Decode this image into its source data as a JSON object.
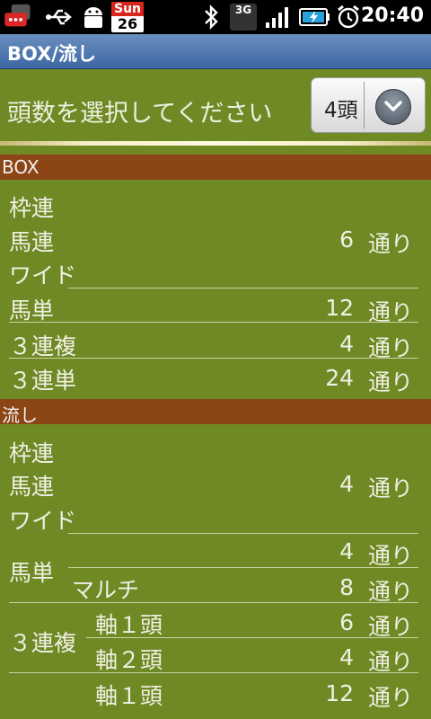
{
  "status_bar": {
    "time": "20:40",
    "calendar_day": "Sun",
    "calendar_date": "26",
    "network_label": "3G",
    "icons": [
      "messaging-icon",
      "usb-icon",
      "android-icon",
      "calendar-icon",
      "bluetooth-icon",
      "3g-icon",
      "signal-icon",
      "battery-charging-icon",
      "alarm-icon"
    ]
  },
  "title": "BOX/流し",
  "header": {
    "prompt": "頭数を選択してください",
    "spinner_value": "4頭"
  },
  "box_section": {
    "title": "BOX",
    "rows": [
      {
        "label": "枠連",
        "count": "",
        "unit": ""
      },
      {
        "label": "馬連",
        "count": "6",
        "unit": "通り"
      },
      {
        "label": "ワイド",
        "count": "",
        "unit": ""
      },
      {
        "label": "馬単",
        "count": "12",
        "unit": "通り"
      },
      {
        "label": "３連複",
        "count": "4",
        "unit": "通り"
      },
      {
        "label": "３連単",
        "count": "24",
        "unit": "通り"
      }
    ]
  },
  "nagashi_section": {
    "title": "流し",
    "rows": [
      {
        "label": "枠連",
        "count": "",
        "unit": ""
      },
      {
        "label": "馬連",
        "count": "4",
        "unit": "通り"
      },
      {
        "label": "ワイド",
        "count": "",
        "unit": ""
      }
    ],
    "umatan": {
      "label": "馬単",
      "rows": [
        {
          "sub": "",
          "count": "4",
          "unit": "通り"
        },
        {
          "sub": "マルチ",
          "count": "8",
          "unit": "通り"
        }
      ]
    },
    "sanrenpuku": {
      "label": "３連複",
      "rows": [
        {
          "sub": "軸１頭",
          "count": "6",
          "unit": "通り"
        },
        {
          "sub": "軸２頭",
          "count": "4",
          "unit": "通り"
        }
      ]
    },
    "extra_row": {
      "sub": "軸１頭",
      "count": "12",
      "unit": "通り"
    }
  },
  "colors": {
    "background": "#6f8a25",
    "section_header": "#8c4515",
    "title_bar": "#3d67a3"
  }
}
